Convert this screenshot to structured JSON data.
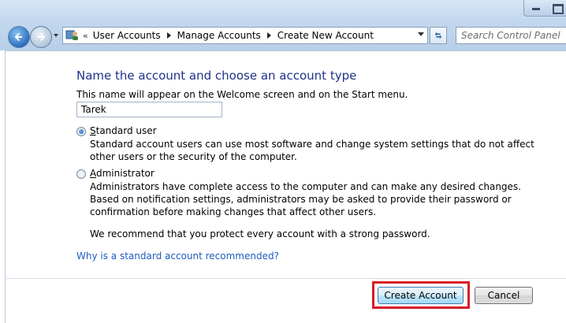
{
  "breadcrumb": {
    "overflow": "«",
    "items": [
      "User Accounts",
      "Manage Accounts",
      "Create New Account"
    ]
  },
  "search": {
    "placeholder": "Search Control Panel"
  },
  "form": {
    "heading": "Name the account and choose an account type",
    "description": "This name will appear on the Welcome screen and on the Start menu.",
    "account_name": "Tarek",
    "options": [
      {
        "label_first": "S",
        "label_rest": "tandard user",
        "selected": true,
        "description": "Standard account users can use most software and change system settings that do not affect other users or the security of the computer."
      },
      {
        "label_first": "A",
        "label_rest": "dministrator",
        "selected": false,
        "description": "Administrators have complete access to the computer and can make any desired changes. Based on notification settings, administrators may be asked to provide their password or confirmation before making changes that affect other users."
      }
    ],
    "recommendation": "We recommend that you protect every account with a strong password.",
    "help_link": "Why is a standard account recommended?"
  },
  "buttons": {
    "create": "Create Account",
    "cancel": "Cancel"
  },
  "colors": {
    "heading": "#1e3287",
    "link": "#1e5cbf",
    "highlight": "#d81e28"
  }
}
